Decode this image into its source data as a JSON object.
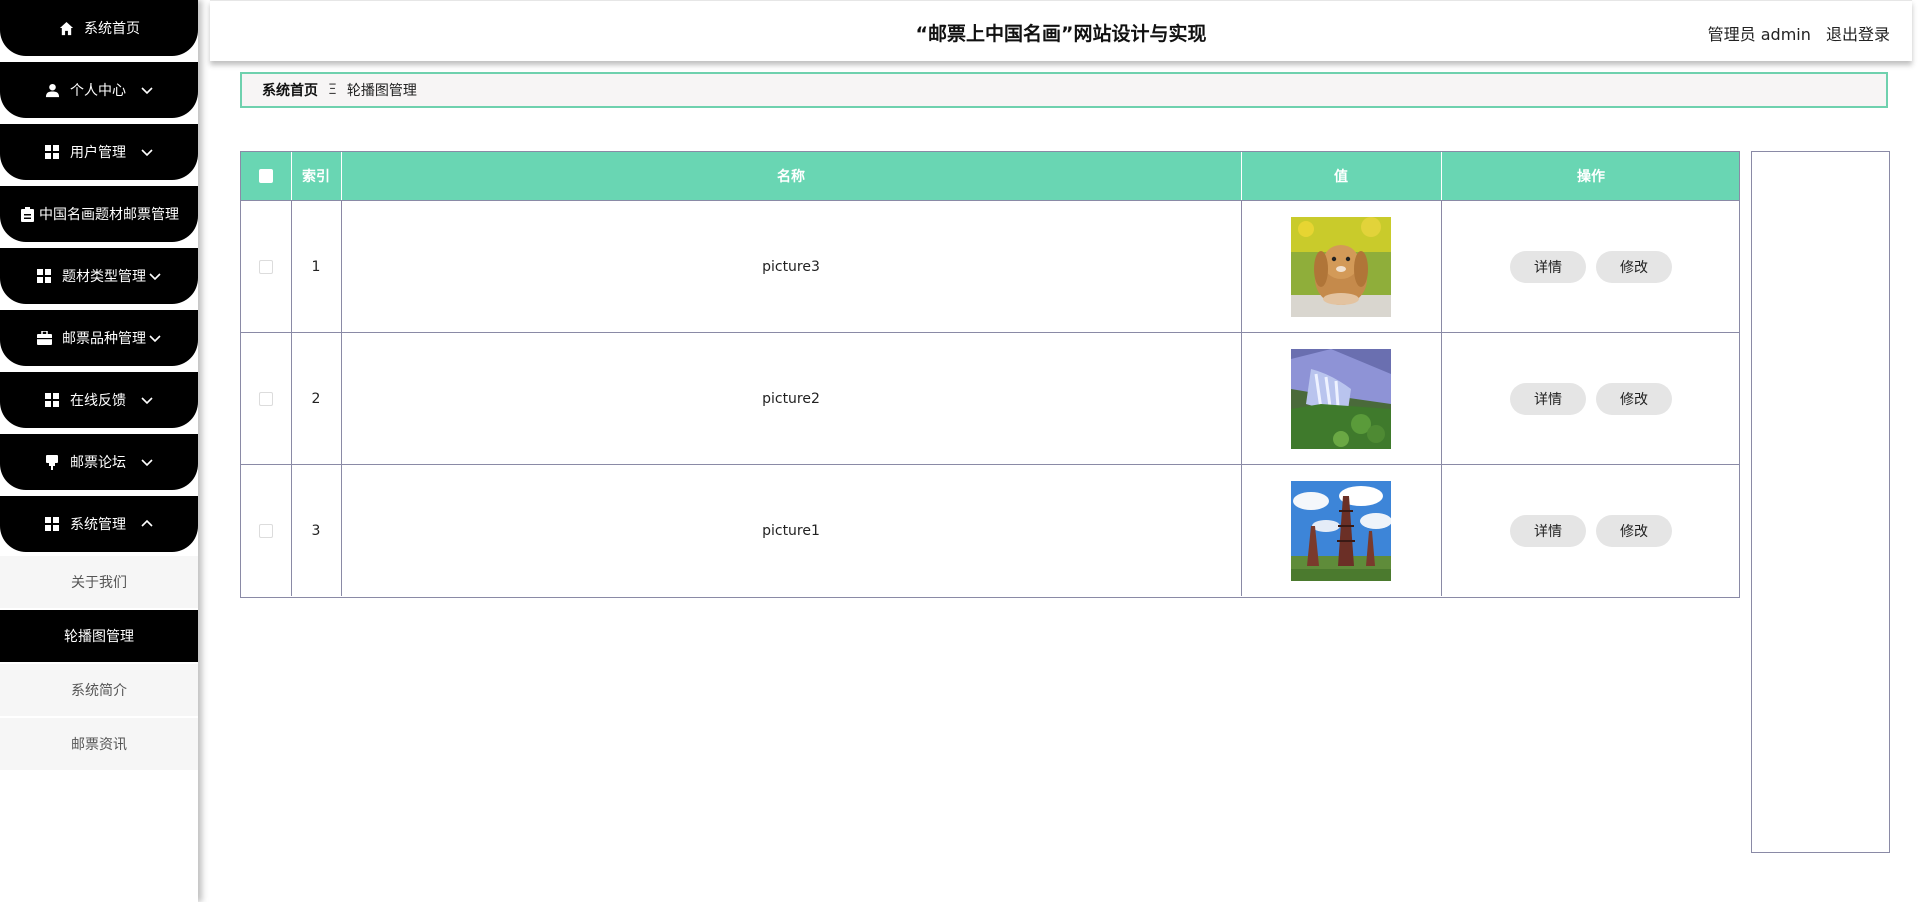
{
  "app": {
    "title": "“邮票上中国名画”网站设计与实现",
    "user_role": "管理员 admin",
    "logout_label": "退出登录"
  },
  "sidebar": {
    "items": [
      {
        "label": "系统首页",
        "icon": "home-icon"
      },
      {
        "label": "个人中心",
        "icon": "person-icon"
      },
      {
        "label": "用户管理",
        "icon": "grid-icon"
      },
      {
        "label": "中国名画题材邮票管理",
        "icon": "clipboard-icon"
      },
      {
        "label": "题材类型管理",
        "icon": "grid-icon"
      },
      {
        "label": "邮票品种管理",
        "icon": "briefcase-icon"
      },
      {
        "label": "在线反馈",
        "icon": "grid-icon"
      },
      {
        "label": "邮票论坛",
        "icon": "pin-icon"
      },
      {
        "label": "系统管理",
        "icon": "grid-icon"
      }
    ],
    "submenu": [
      {
        "label": "关于我们"
      },
      {
        "label": "轮播图管理"
      },
      {
        "label": "系统简介"
      },
      {
        "label": "邮票资讯"
      }
    ]
  },
  "breadcrumb": {
    "home": "系统首页",
    "separator": "Ξ",
    "current": "轮播图管理"
  },
  "table": {
    "header_color": "#69d6b3",
    "columns": [
      "索引",
      "名称",
      "值",
      "操作"
    ],
    "rows": [
      {
        "index": "1",
        "name": "picture3",
        "image": "rabbit"
      },
      {
        "index": "2",
        "name": "picture2",
        "image": "waterfall"
      },
      {
        "index": "3",
        "name": "picture1",
        "image": "pagoda"
      }
    ],
    "detail_label": "详情",
    "edit_label": "修改"
  }
}
